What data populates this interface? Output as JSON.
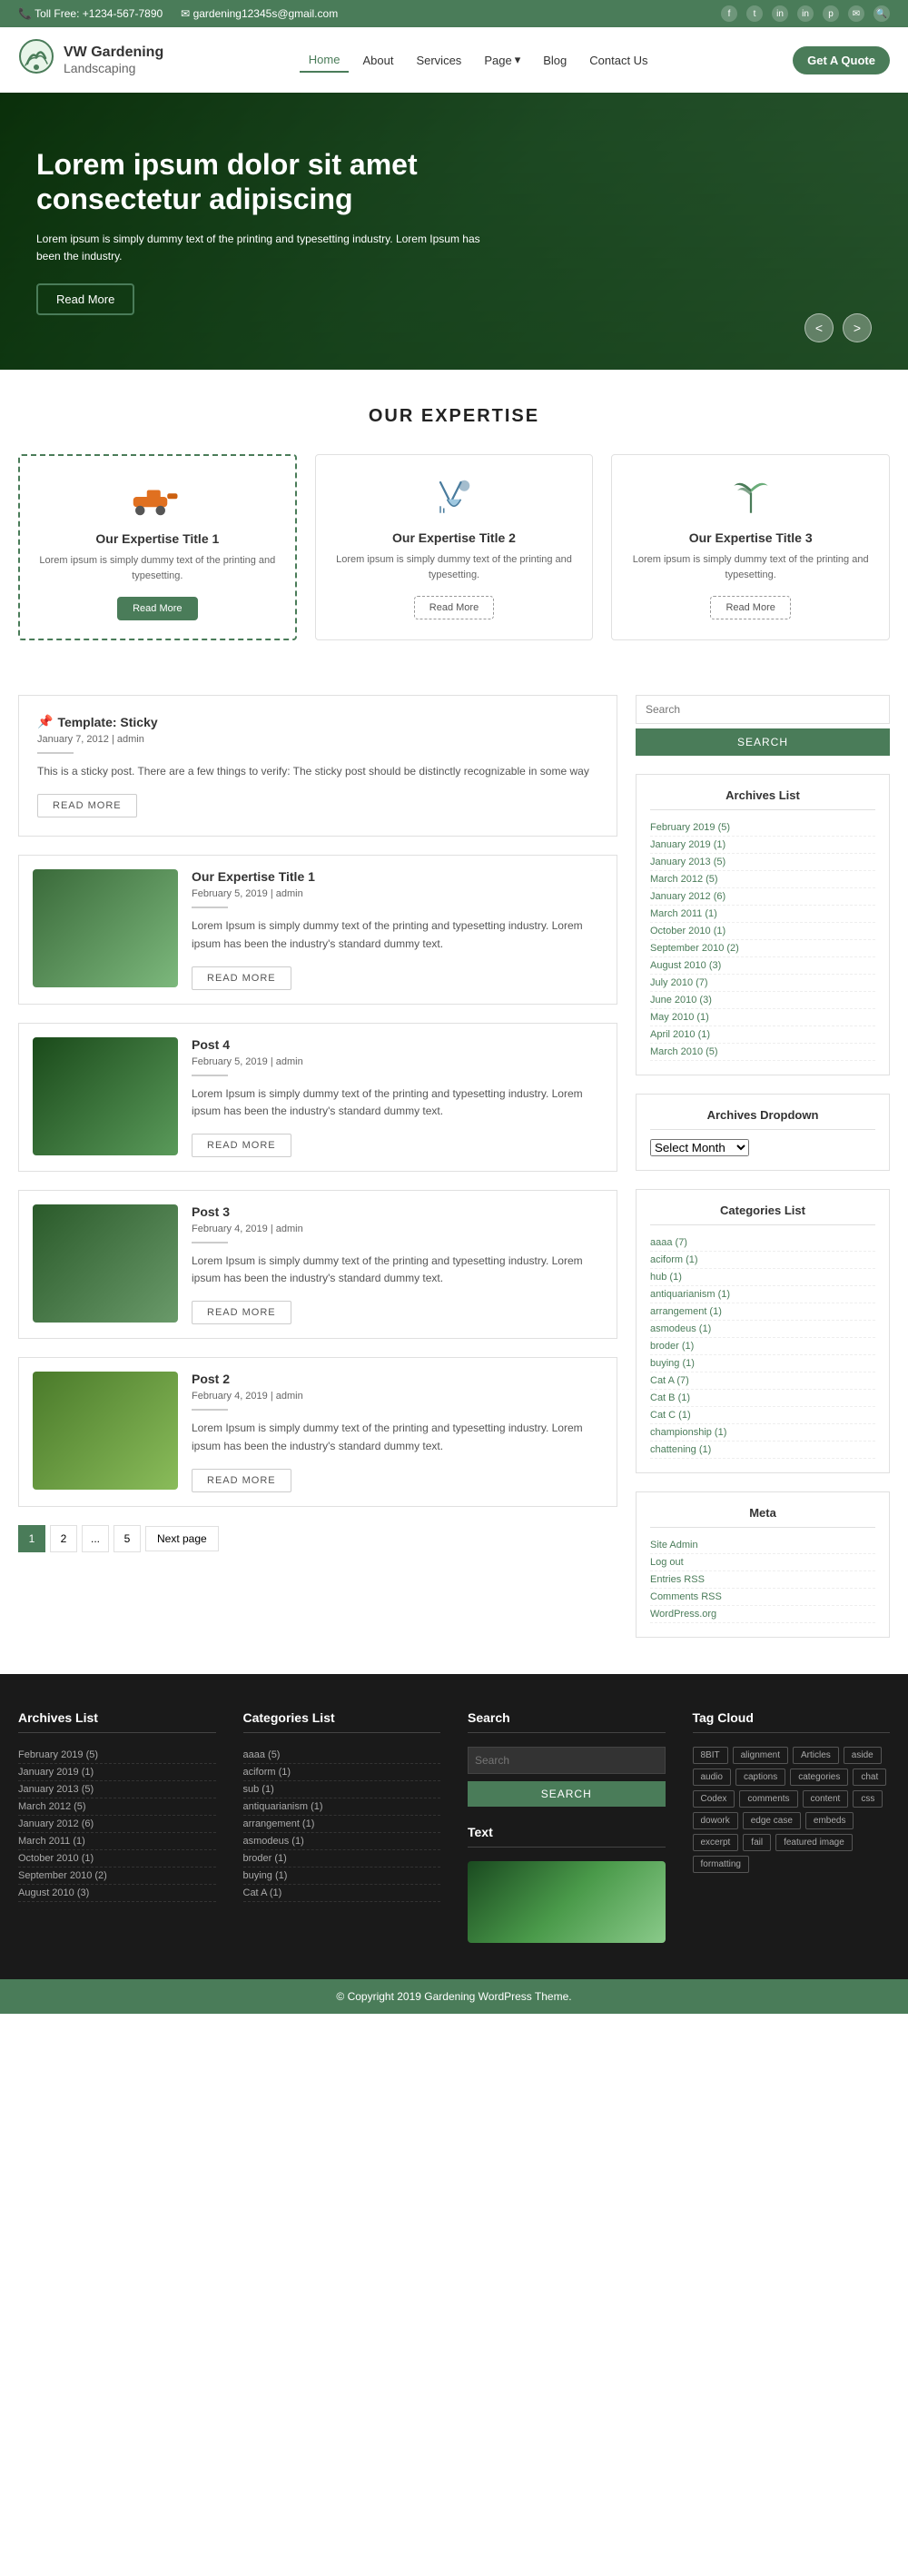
{
  "topbar": {
    "phone_icon": "📞",
    "phone": "Toll Free: +1234-567-7890",
    "email_icon": "✉",
    "email": "gardening12345s@gmail.com",
    "search_icon": "🔍",
    "socials": [
      "f",
      "t",
      "in",
      "in",
      "p",
      "✉"
    ]
  },
  "header": {
    "logo_icon": "🌿",
    "brand": "VW Gardening",
    "sub": "Landscaping",
    "nav": [
      {
        "label": "Home",
        "active": true
      },
      {
        "label": "About",
        "active": false
      },
      {
        "label": "Services",
        "active": false
      },
      {
        "label": "Page",
        "active": false,
        "dropdown": true
      },
      {
        "label": "Blog",
        "active": false
      },
      {
        "label": "Contact Us",
        "active": false
      }
    ],
    "quote_btn": "Get A Quote"
  },
  "hero": {
    "title": "Lorem ipsum dolor sit amet consectetur adipiscing",
    "text": "Lorem ipsum is simply dummy text of the printing and typesetting industry. Lorem Ipsum has been the industry.",
    "btn": "Read More",
    "prev": "<",
    "next": ">"
  },
  "expertise": {
    "section_title": "OUR EXPERTISE",
    "cards": [
      {
        "title": "Our Expertise Title 1",
        "text": "Lorem ipsum is simply dummy text of the printing and typesetting.",
        "btn": "Read More",
        "active": true
      },
      {
        "title": "Our Expertise Title 2",
        "text": "Lorem ipsum is simply dummy text of the printing and typesetting.",
        "btn": "Read More",
        "active": false
      },
      {
        "title": "Our Expertise Title 3",
        "text": "Lorem ipsum is simply dummy text of the printing and typesetting.",
        "btn": "Read More",
        "active": false
      }
    ]
  },
  "blog": {
    "posts": [
      {
        "type": "sticky",
        "title": "Template: Sticky",
        "date": "January 7, 2012",
        "author": "admin",
        "text": "This is a sticky post. There are a few things to verify: The sticky post should be distinctly recognizable in some way",
        "btn": "READ MORE"
      },
      {
        "type": "with-image",
        "title": "Our Expertise Title 1",
        "date": "February 5, 2019",
        "author": "admin",
        "text": "Lorem Ipsum is simply dummy text of the printing and typesetting industry. Lorem ipsum has been the industry's standard dummy text.",
        "btn": "READ MORE",
        "thumb_color": "#5a8a6a"
      },
      {
        "type": "with-image",
        "title": "Post 4",
        "date": "February 5, 2019",
        "author": "admin",
        "text": "Lorem Ipsum is simply dummy text of the printing and typesetting industry. Lorem ipsum has been the industry's standard dummy text.",
        "btn": "READ MORE",
        "thumb_color": "#3a6a3a"
      },
      {
        "type": "with-image",
        "title": "Post 3",
        "date": "February 4, 2019",
        "author": "admin",
        "text": "Lorem Ipsum is simply dummy text of the printing and typesetting industry. Lorem ipsum has been the industry's standard dummy text.",
        "btn": "READ MORE",
        "thumb_color": "#4a7a5a"
      },
      {
        "type": "with-image",
        "title": "Post 2",
        "date": "February 4, 2019",
        "author": "admin",
        "text": "Lorem Ipsum is simply dummy text of the printing and typesetting industry. Lorem ipsum has been the industry's standard dummy text.",
        "btn": "READ MORE",
        "thumb_color": "#6a8a4a"
      }
    ]
  },
  "pagination": {
    "pages": [
      "1",
      "2",
      "...",
      "5"
    ],
    "next": "Next page"
  },
  "sidebar": {
    "search_placeholder": "Search",
    "search_btn": "SEARCH",
    "archives_title": "Archives List",
    "archives": [
      "February 2019 (5)",
      "January 2019 (1)",
      "January 2013 (5)",
      "March 2012 (5)",
      "January 2012 (6)",
      "March 2011 (1)",
      "October 2010 (1)",
      "September 2010 (2)",
      "August 2010 (3)",
      "July 2010 (7)",
      "June 2010 (3)",
      "May 2010 (1)",
      "April 2010 (1)",
      "March 2010 (5)"
    ],
    "archives_dropdown_title": "Archives Dropdown",
    "archives_dropdown_placeholder": "Select Month",
    "categories_title": "Categories List",
    "categories": [
      "aaaa (7)",
      "aciform (1)",
      "hub (1)",
      "antiquarianism (1)",
      "arrangement (1)",
      "asmodeus (1)",
      "broder (1)",
      "buying (1)",
      "Cat A (7)",
      "Cat B (1)",
      "Cat C (1)",
      "championship (1)",
      "chattening (1)"
    ],
    "meta_title": "Meta",
    "meta_links": [
      "Site Admin",
      "Log out",
      "Entries RSS",
      "Comments RSS",
      "WordPress.org"
    ]
  },
  "footer_widgets": {
    "archives": {
      "title": "Archives List",
      "items": [
        "February 2019 (5)",
        "January 2019 (1)",
        "January 2013 (5)",
        "March 2012 (5)",
        "January 2012 (6)",
        "March 2011 (1)",
        "October 2010 (1)",
        "September 2010 (2)",
        "August 2010 (3)"
      ]
    },
    "categories": {
      "title": "Categories List",
      "items": [
        "aaaa (5)",
        "aciform (1)",
        "sub (1)",
        "antiquarianism (1)",
        "arrangement (1)",
        "asmodeus (1)",
        "broder (1)",
        "buying (1)",
        "Cat A (1)"
      ]
    },
    "search": {
      "title": "Search",
      "placeholder": "Search",
      "btn": "SEARCH",
      "text_title": "Text"
    },
    "tagcloud": {
      "title": "Tag Cloud",
      "tags": [
        "8BIT",
        "alignment",
        "Articles",
        "aside",
        "audio",
        "captions",
        "categories",
        "chat",
        "Codex",
        "comments",
        "content",
        "css",
        "dowork",
        "edge case",
        "embeds",
        "excerpt",
        "fail",
        "featured image",
        "formatting"
      ]
    }
  },
  "footer_bottom": {
    "text": "© Copyright 2019 Gardening WordPress Theme."
  }
}
